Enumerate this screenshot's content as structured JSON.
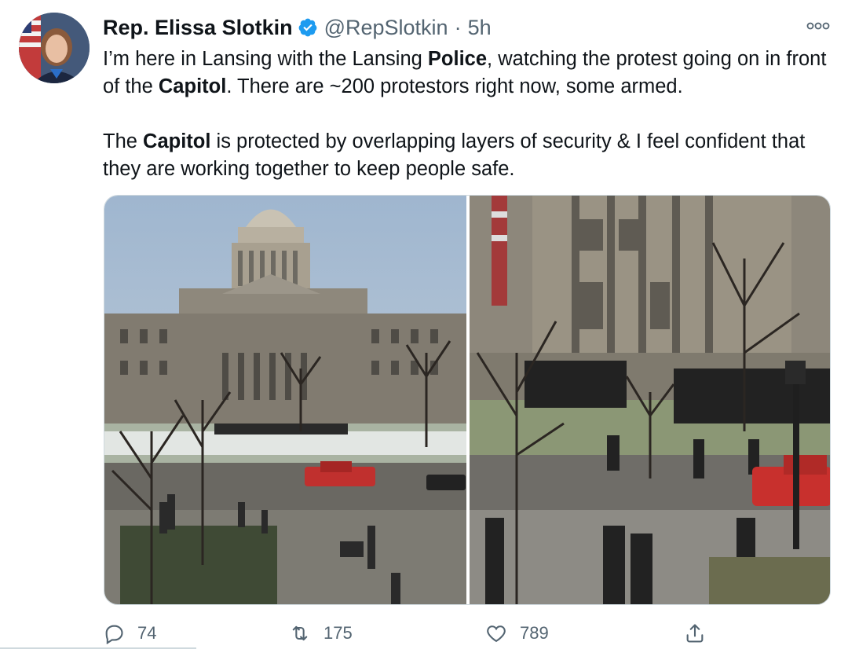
{
  "author": {
    "name": "Rep. Elissa Slotkin",
    "handle": "@RepSlotkin",
    "separator": "·",
    "time": "5h"
  },
  "tweet": {
    "p1_a": "I’m here in Lansing with the Lansing ",
    "p1_b": "Police",
    "p1_c": ", watching the protest going on in front of the ",
    "p1_d": "Capitol",
    "p1_e": ". There are ~200 protestors right now, some armed.",
    "p2_a": "The ",
    "p2_b": "Capitol",
    "p2_c": " is protected by overlapping layers of security & I feel confident that they are working together to keep people safe."
  },
  "actions": {
    "replies": "74",
    "retweets": "175",
    "likes": "789"
  },
  "colors": {
    "text": "#0f1419",
    "secondary": "#536471",
    "verified": "#1d9bf0"
  },
  "icons": {
    "verified": "verified-badge-icon",
    "more": "more-options-icon",
    "reply": "reply-icon",
    "retweet": "retweet-icon",
    "like": "heart-icon",
    "share": "share-icon"
  }
}
